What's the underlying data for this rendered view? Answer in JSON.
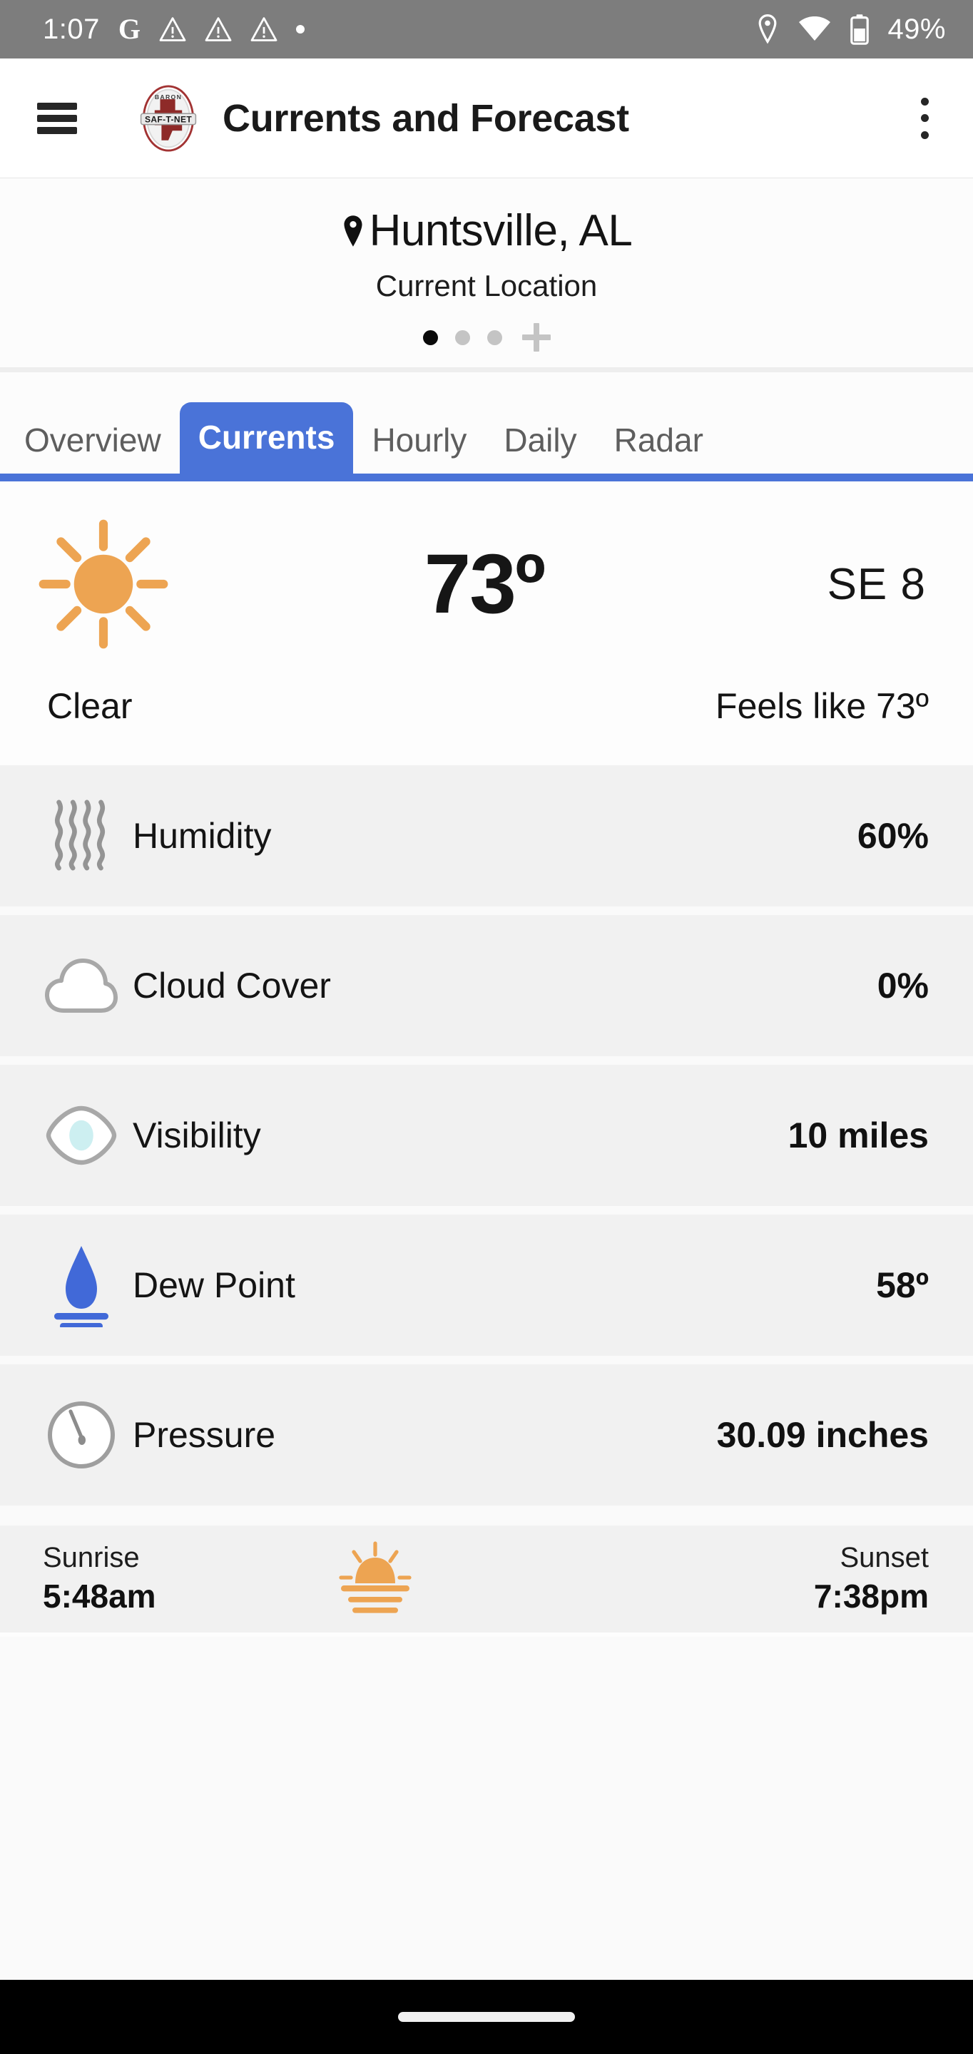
{
  "status_bar": {
    "time": "1:07",
    "google_glyph": "G",
    "icons_left": [
      "google-icon",
      "warning-triangle-icon",
      "warning-triangle-icon",
      "warning-triangle-icon",
      "dot-icon"
    ],
    "icons_right": [
      "location-pin-icon",
      "wifi-icon",
      "battery-icon"
    ],
    "battery_percent": "49%",
    "background": "#7d7d7d"
  },
  "app_bar": {
    "menu_icon": "hamburger-menu-icon",
    "logo_alt": "SAF-T-NET",
    "logo_top_text": "BARON",
    "logo_banner_text": "SAF-T-NET",
    "title": "Currents and Forecast",
    "overflow_icon": "kebab-menu-icon"
  },
  "location": {
    "pin_icon": "map-pin-icon",
    "name": "Huntsville, AL",
    "subtitle": "Current Location",
    "pager": {
      "total": 3,
      "active_index": 0,
      "add_label": "+"
    }
  },
  "tabs": {
    "items": [
      {
        "label": "Overview",
        "active": false
      },
      {
        "label": "Currents",
        "active": true
      },
      {
        "label": "Hourly",
        "active": false
      },
      {
        "label": "Daily",
        "active": false
      },
      {
        "label": "Radar",
        "active": false
      }
    ],
    "accent_color": "#4a73d8"
  },
  "current": {
    "weather_icon": "sun-icon",
    "temperature": "73º",
    "wind": "SE 8",
    "condition": "Clear",
    "feels_like": "Feels like 73º",
    "sun_color": "#eda452"
  },
  "details": [
    {
      "icon": "humidity-waves-icon",
      "label": "Humidity",
      "value": "60%"
    },
    {
      "icon": "cloud-icon",
      "label": "Cloud Cover",
      "value": "0%"
    },
    {
      "icon": "eye-visibility-icon",
      "label": "Visibility",
      "value": "10 miles"
    },
    {
      "icon": "water-drop-icon",
      "label": "Dew Point",
      "value": "58º"
    },
    {
      "icon": "barometer-gauge-icon",
      "label": "Pressure",
      "value": "30.09 inches"
    }
  ],
  "sun_times": {
    "sunrise_label": "Sunrise",
    "sunrise_value": "5:48am",
    "sunset_label": "Sunset",
    "sunset_value": "7:38pm",
    "icon": "sunrise-icon"
  },
  "nav_bar": {
    "home_indicator": "home-pill-indicator"
  }
}
